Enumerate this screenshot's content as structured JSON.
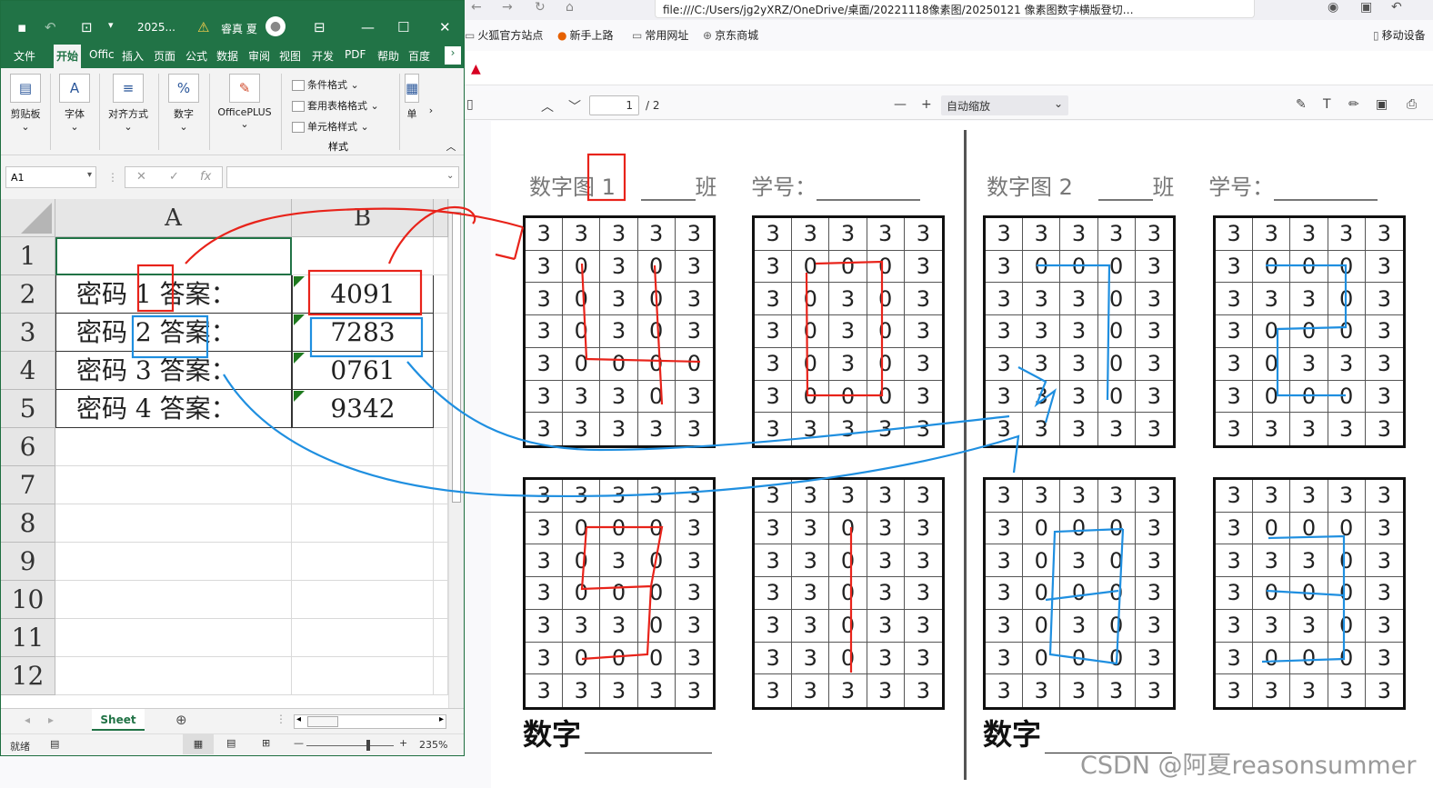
{
  "browser": {
    "address": "file:///C:/Users/jg2yXRZ/OneDrive/桌面/20221118像素图/20250121 像素图数字横版登切…",
    "bookmarks": [
      "火狐官方站点",
      "新手上路",
      "常用网址",
      "京东商城"
    ],
    "mobile_label": "移动设备",
    "pdf_page": "1",
    "pdf_total": "/ 2",
    "zoom_label": "自动缩放"
  },
  "pdf": {
    "titles": [
      {
        "name": "数字图 1",
        "class": "班",
        "id": "学号："
      },
      {
        "name": "数字图 2",
        "class": "班",
        "id": "学号："
      }
    ],
    "footer": "数字",
    "grids": [
      [
        "3",
        "3",
        "3",
        "3",
        "3",
        "3",
        "0",
        "3",
        "0",
        "3",
        "3",
        "0",
        "3",
        "0",
        "3",
        "3",
        "0",
        "3",
        "0",
        "3",
        "3",
        "0",
        "0",
        "0",
        "0",
        "3",
        "3",
        "3",
        "0",
        "3",
        "3",
        "3",
        "3",
        "3",
        "3"
      ],
      [
        "3",
        "3",
        "3",
        "3",
        "3",
        "3",
        "0",
        "0",
        "0",
        "3",
        "3",
        "0",
        "3",
        "0",
        "3",
        "3",
        "0",
        "3",
        "0",
        "3",
        "3",
        "0",
        "3",
        "0",
        "3",
        "3",
        "0",
        "0",
        "0",
        "3",
        "3",
        "3",
        "3",
        "3",
        "3"
      ],
      [
        "3",
        "3",
        "3",
        "3",
        "3",
        "3",
        "0",
        "0",
        "0",
        "3",
        "3",
        "3",
        "3",
        "0",
        "3",
        "3",
        "3",
        "3",
        "0",
        "3",
        "3",
        "3",
        "3",
        "0",
        "3",
        "3",
        "3",
        "3",
        "0",
        "3",
        "3",
        "3",
        "3",
        "3",
        "3"
      ],
      [
        "3",
        "3",
        "3",
        "3",
        "3",
        "3",
        "0",
        "0",
        "0",
        "3",
        "3",
        "3",
        "3",
        "0",
        "3",
        "3",
        "0",
        "0",
        "0",
        "3",
        "3",
        "0",
        "3",
        "3",
        "3",
        "3",
        "0",
        "0",
        "0",
        "3",
        "3",
        "3",
        "3",
        "3",
        "3"
      ],
      [
        "3",
        "3",
        "3",
        "3",
        "3",
        "3",
        "0",
        "0",
        "0",
        "3",
        "3",
        "0",
        "3",
        "0",
        "3",
        "3",
        "0",
        "0",
        "0",
        "3",
        "3",
        "3",
        "3",
        "0",
        "3",
        "3",
        "0",
        "0",
        "0",
        "3",
        "3",
        "3",
        "3",
        "3",
        "3"
      ],
      [
        "3",
        "3",
        "3",
        "3",
        "3",
        "3",
        "3",
        "0",
        "3",
        "3",
        "3",
        "3",
        "0",
        "3",
        "3",
        "3",
        "3",
        "0",
        "3",
        "3",
        "3",
        "3",
        "0",
        "3",
        "3",
        "3",
        "3",
        "0",
        "3",
        "3",
        "3",
        "3",
        "3",
        "3",
        "3"
      ],
      [
        "3",
        "3",
        "3",
        "3",
        "3",
        "3",
        "0",
        "0",
        "0",
        "3",
        "3",
        "0",
        "3",
        "0",
        "3",
        "3",
        "0",
        "0",
        "0",
        "3",
        "3",
        "0",
        "3",
        "0",
        "3",
        "3",
        "0",
        "0",
        "0",
        "3",
        "3",
        "3",
        "3",
        "3",
        "3"
      ],
      [
        "3",
        "3",
        "3",
        "3",
        "3",
        "3",
        "0",
        "0",
        "0",
        "3",
        "3",
        "3",
        "3",
        "0",
        "3",
        "3",
        "0",
        "0",
        "0",
        "3",
        "3",
        "3",
        "3",
        "0",
        "3",
        "3",
        "0",
        "0",
        "0",
        "3",
        "3",
        "3",
        "3",
        "3",
        "3"
      ]
    ]
  },
  "excel": {
    "file": "2025...",
    "user": "睿真 夏",
    "tabs": [
      "文件",
      "开始",
      "Offic",
      "插入",
      "页面",
      "公式",
      "数据",
      "审阅",
      "视图",
      "开发",
      "PDF",
      "帮助",
      "百度"
    ],
    "ribbon": {
      "clipboard": "剪贴板",
      "font": "字体",
      "align": "对齐方式",
      "number": "数字",
      "officeplus": "OfficePLUS",
      "cond": "条件格式",
      "table": "套用表格格式",
      "cellstyle": "单元格样式",
      "styles": "样式",
      "cells": "单"
    },
    "name_box": "A1",
    "columns": [
      "A",
      "B"
    ],
    "rows": [
      "1",
      "2",
      "3",
      "4",
      "5",
      "6",
      "7",
      "8",
      "9",
      "10",
      "11",
      "12"
    ],
    "cells": [
      {
        "a": "",
        "b": ""
      },
      {
        "a": "密码 1 答案：",
        "b": "4091"
      },
      {
        "a": "密码 2 答案：",
        "b": "7283"
      },
      {
        "a": "密码 3 答案：",
        "b": "0761"
      },
      {
        "a": "密码 4 答案：",
        "b": "9342"
      }
    ],
    "sheet_tab": "Sheet",
    "status_ready": "就绪",
    "zoom": "235%"
  },
  "watermark": "CSDN @阿夏reasonsummer"
}
